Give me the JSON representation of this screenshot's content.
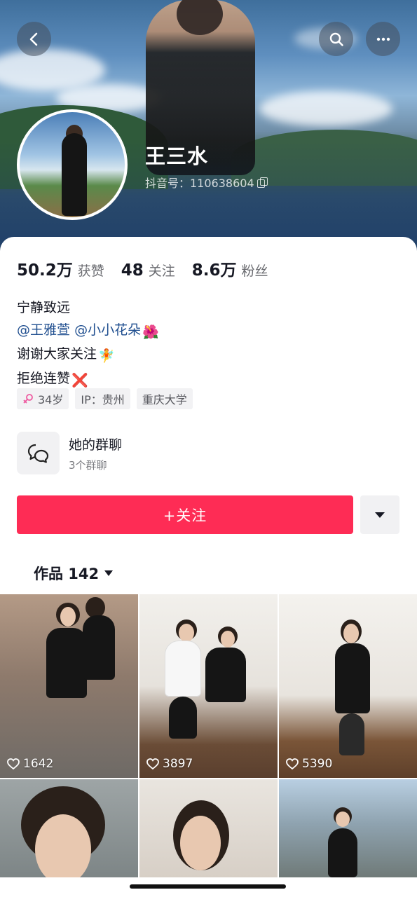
{
  "header": {
    "back_icon": "back-arrow-icon",
    "search_icon": "search-icon",
    "more_icon": "more-dots-icon"
  },
  "profile": {
    "name": "王三水",
    "douyin_id": "抖音号：110638604",
    "copy_icon": "copy-icon"
  },
  "stats": [
    {
      "value": "50.2万",
      "label": "获赞"
    },
    {
      "value": "48",
      "label": "关注"
    },
    {
      "value": "8.6万",
      "label": "粉丝"
    }
  ],
  "bio": {
    "line1": "宁静致远",
    "mention1": "@王雅萱",
    "mention2": "@小小花朵",
    "mention2_emoji": "🌺",
    "line3": "谢谢大家关注",
    "line3_emoji": "🧚",
    "line4": "拒绝连赞",
    "line4_emoji": "❌"
  },
  "tags": [
    {
      "icon": "female-icon",
      "label": "34岁"
    },
    {
      "label": "IP：贵州"
    },
    {
      "label": "重庆大学"
    }
  ],
  "group_chat": {
    "icon": "group-chat-icon",
    "title": "她的群聊",
    "subtitle": "3个群聊"
  },
  "actions": {
    "follow_label": "+关注",
    "dropdown_icon": "caret-down-icon"
  },
  "works_tab": {
    "label": "作品 142",
    "icon": "caret-down-icon"
  },
  "videos": [
    {
      "likes": "1642"
    },
    {
      "likes": "3897"
    },
    {
      "likes": "5390"
    },
    {
      "likes": ""
    },
    {
      "likes": ""
    },
    {
      "likes": ""
    }
  ],
  "colors": {
    "accent": "#fe2c55",
    "mention": "#1f4e8f",
    "muted_text": "#6a6b70"
  }
}
